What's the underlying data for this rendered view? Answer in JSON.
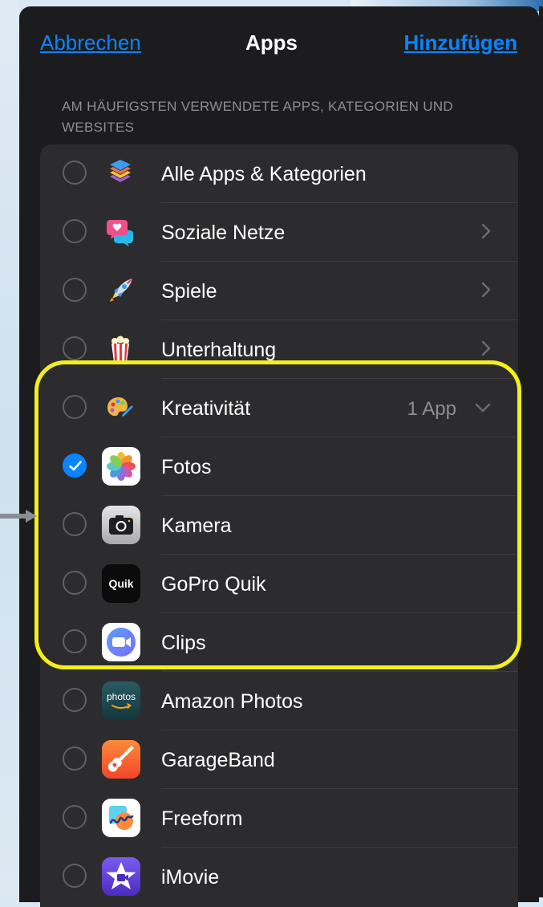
{
  "nav": {
    "cancel_label": "Abbrechen",
    "title": "Apps",
    "add_label": "Hinzufügen"
  },
  "section_header": "AM HÄUFIGSTEN VERWENDETE APPS, KATEGORIEN UND WEBSITES",
  "categories": [
    {
      "label": "Alle Apps & Kategorien",
      "icon": "stack-icon"
    },
    {
      "label": "Soziale Netze",
      "icon": "speech-bubbles-icon"
    },
    {
      "label": "Spiele",
      "icon": "rocket-icon"
    },
    {
      "label": "Unterhaltung",
      "icon": "popcorn-icon"
    },
    {
      "label": "Kreativität",
      "icon": "palette-icon",
      "detail": "1 App",
      "expanded": true
    }
  ],
  "apps": [
    {
      "label": "Fotos",
      "icon": "photos-icon",
      "selected": true
    },
    {
      "label": "Kamera",
      "icon": "camera-icon",
      "selected": false
    },
    {
      "label": "GoPro Quik",
      "icon": "gopro-quik-icon",
      "icon_text": "Quik",
      "selected": false
    },
    {
      "label": "Clips",
      "icon": "clips-icon",
      "selected": false
    },
    {
      "label": "Amazon Photos",
      "icon": "amazon-photos-icon",
      "icon_text": "photos",
      "selected": false
    },
    {
      "label": "GarageBand",
      "icon": "garageband-icon",
      "selected": false
    },
    {
      "label": "Freeform",
      "icon": "freeform-icon",
      "selected": false
    },
    {
      "label": "iMovie",
      "icon": "imovie-icon",
      "selected": false
    }
  ],
  "colors": {
    "accent": "#0a84ff",
    "highlight": "#f4ef1c",
    "sheet": "#1c1c1e",
    "group": "#2c2c2e"
  }
}
